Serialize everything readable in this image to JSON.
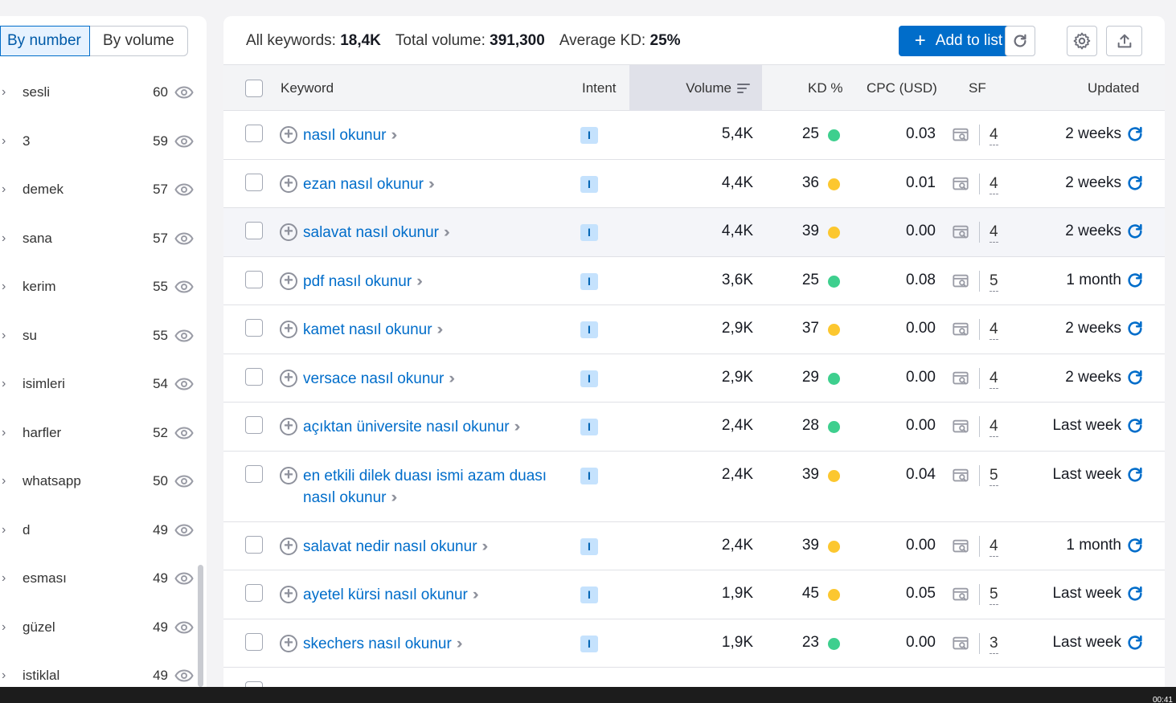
{
  "left": {
    "seg_by_number": "By number",
    "seg_by_volume": "By volume",
    "words": [
      {
        "label": "sesli",
        "count": "60"
      },
      {
        "label": "3",
        "count": "59"
      },
      {
        "label": "demek",
        "count": "57"
      },
      {
        "label": "sana",
        "count": "57"
      },
      {
        "label": "kerim",
        "count": "55"
      },
      {
        "label": "su",
        "count": "55"
      },
      {
        "label": "isimleri",
        "count": "54"
      },
      {
        "label": "harfler",
        "count": "52"
      },
      {
        "label": "whatsapp",
        "count": "50"
      },
      {
        "label": "d",
        "count": "49"
      },
      {
        "label": "esması",
        "count": "49"
      },
      {
        "label": "güzel",
        "count": "49"
      },
      {
        "label": "istiklal",
        "count": "49"
      }
    ]
  },
  "summary": {
    "all_keywords_label": "All keywords:",
    "all_keywords_value": "18,4K",
    "total_volume_label": "Total volume:",
    "total_volume_value": "391,300",
    "avg_kd_label": "Average KD:",
    "avg_kd_value": "25%"
  },
  "toolbar": {
    "add_to_list": "Add to list",
    "refresh_icon": "refresh-icon",
    "settings_icon": "gear-icon",
    "export_icon": "export-icon",
    "accent_color": "#006dca"
  },
  "table": {
    "headers": {
      "keyword": "Keyword",
      "intent": "Intent",
      "volume": "Volume",
      "kd": "KD %",
      "cpc": "CPC (USD)",
      "sf": "SF",
      "updated": "Updated"
    },
    "rows": [
      {
        "keyword": "nasıl okunur",
        "intent": "I",
        "volume": "5,4K",
        "kd": "25",
        "kd_color": "#3ecf8e",
        "cpc": "0.03",
        "sf": "4",
        "updated": "2 weeks"
      },
      {
        "keyword": "ezan nasıl okunur",
        "intent": "I",
        "volume": "4,4K",
        "kd": "36",
        "kd_color": "#fcc72f",
        "cpc": "0.01",
        "sf": "4",
        "updated": "2 weeks"
      },
      {
        "keyword": "salavat nasıl okunur",
        "intent": "I",
        "volume": "4,4K",
        "kd": "39",
        "kd_color": "#fcc72f",
        "cpc": "0.00",
        "sf": "4",
        "updated": "2 weeks"
      },
      {
        "keyword": "pdf nasıl okunur",
        "intent": "I",
        "volume": "3,6K",
        "kd": "25",
        "kd_color": "#3ecf8e",
        "cpc": "0.08",
        "sf": "5",
        "updated": "1 month"
      },
      {
        "keyword": "kamet nasıl okunur",
        "intent": "I",
        "volume": "2,9K",
        "kd": "37",
        "kd_color": "#fcc72f",
        "cpc": "0.00",
        "sf": "4",
        "updated": "2 weeks"
      },
      {
        "keyword": "versace nasıl okunur",
        "intent": "I",
        "volume": "2,9K",
        "kd": "29",
        "kd_color": "#3ecf8e",
        "cpc": "0.00",
        "sf": "4",
        "updated": "2 weeks"
      },
      {
        "keyword": "açıktan üniversite nasıl okunur",
        "intent": "I",
        "volume": "2,4K",
        "kd": "28",
        "kd_color": "#3ecf8e",
        "cpc": "0.00",
        "sf": "4",
        "updated": "Last week"
      },
      {
        "keyword": "en etkili dilek duası ismi azam duası nasıl okunur",
        "intent": "I",
        "volume": "2,4K",
        "kd": "39",
        "kd_color": "#fcc72f",
        "cpc": "0.04",
        "sf": "5",
        "updated": "Last week"
      },
      {
        "keyword": "salavat nedir nasıl okunur",
        "intent": "I",
        "volume": "2,4K",
        "kd": "39",
        "kd_color": "#fcc72f",
        "cpc": "0.00",
        "sf": "4",
        "updated": "1 month"
      },
      {
        "keyword": "ayetel kürsi nasıl okunur",
        "intent": "I",
        "volume": "1,9K",
        "kd": "45",
        "kd_color": "#fcc72f",
        "cpc": "0.05",
        "sf": "5",
        "updated": "Last week"
      },
      {
        "keyword": "skechers nasıl okunur",
        "intent": "I",
        "volume": "1,9K",
        "kd": "23",
        "kd_color": "#3ecf8e",
        "cpc": "0.00",
        "sf": "3",
        "updated": "Last week"
      }
    ]
  },
  "taskbar": {
    "clock": "00:41"
  }
}
